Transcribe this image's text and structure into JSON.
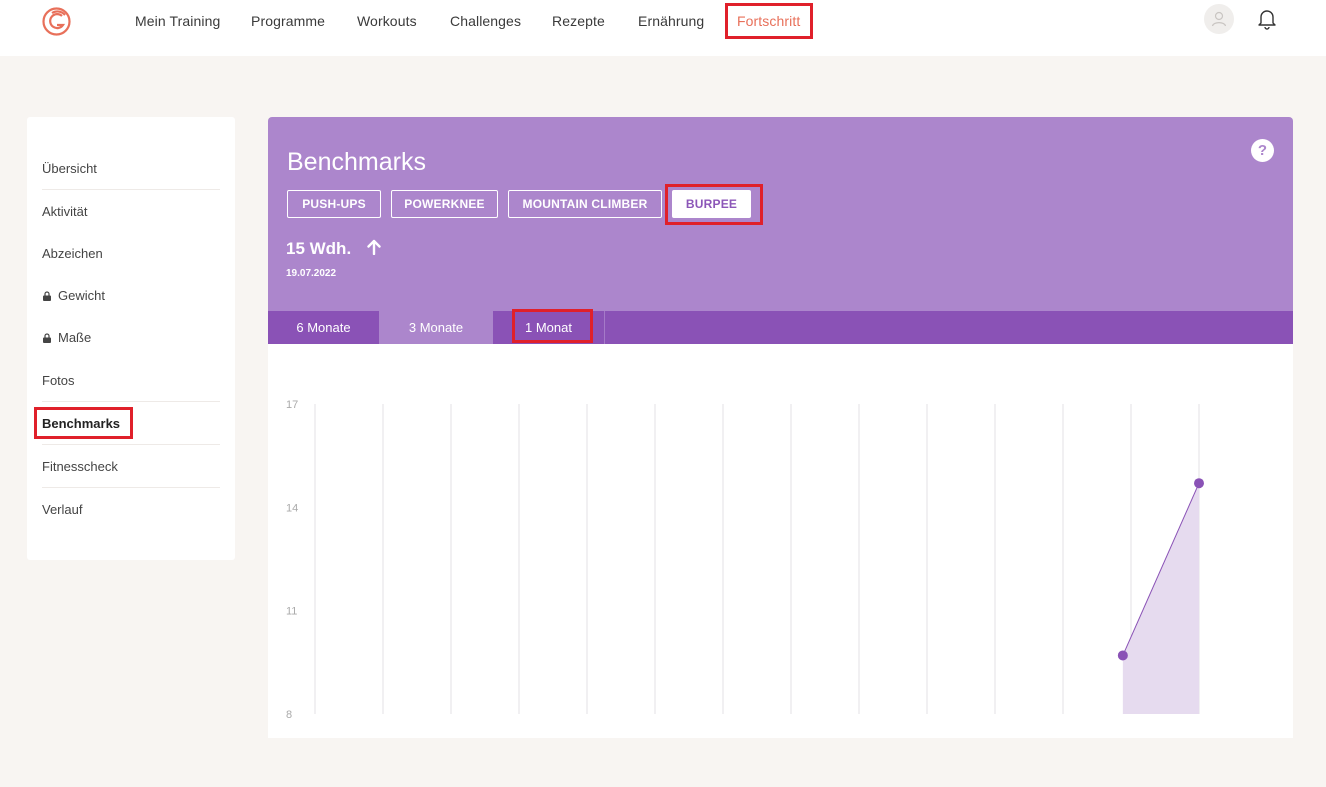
{
  "nav": {
    "items": [
      "Mein Training",
      "Programme",
      "Workouts",
      "Challenges",
      "Rezepte",
      "Ernährung",
      "Fortschritt"
    ],
    "active": "Fortschritt",
    "accent_color": "#e8705a"
  },
  "sidebar": {
    "items": [
      {
        "label": "Übersicht",
        "locked": false
      },
      {
        "label": "Aktivität",
        "locked": false
      },
      {
        "label": "Abzeichen",
        "locked": false
      },
      {
        "label": "Gewicht",
        "locked": true
      },
      {
        "label": "Maße",
        "locked": true
      },
      {
        "label": "Fotos",
        "locked": false
      },
      {
        "label": "Benchmarks",
        "locked": false,
        "active": true
      },
      {
        "label": "Fitnesscheck",
        "locked": false
      },
      {
        "label": "Verlauf",
        "locked": false
      }
    ]
  },
  "panel": {
    "title": "Benchmarks",
    "help_icon": "?",
    "benchmarks": [
      "PUSH-UPS",
      "POWERKNEE",
      "MOUNTAIN CLIMBER",
      "BURPEE"
    ],
    "selected_benchmark": "BURPEE",
    "value": "15 Wdh.",
    "trend_icon": "arrow-up-icon",
    "date": "19.07.2022",
    "background_color": "#ac86cc"
  },
  "tabs": {
    "items": [
      "6 Monate",
      "3 Monate",
      "1 Monat"
    ],
    "selected": "3 Monate",
    "highlighted": "1 Monat"
  },
  "chart_data": {
    "type": "area",
    "y_ticks": [
      "17",
      "14",
      "11",
      "8"
    ],
    "ylim": [
      8,
      17
    ],
    "grid": "vertical",
    "points": [
      {
        "x_index": 11.88,
        "y": 9.7
      },
      {
        "x_index": 13,
        "y": 14.7
      }
    ],
    "color": "#8a52b6",
    "fill_color": "#e6dbef"
  }
}
